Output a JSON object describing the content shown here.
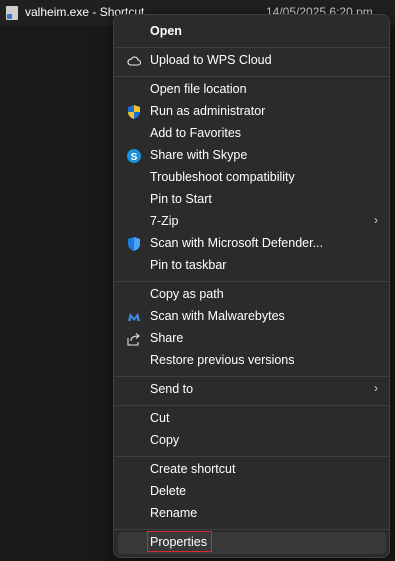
{
  "file": {
    "name": "valheim.exe - Shortcut",
    "date": "14/05/2025 6:20 pm"
  },
  "menu": {
    "open": "Open",
    "upload_wps": "Upload to WPS Cloud",
    "open_file_location": "Open file location",
    "run_as_admin": "Run as administrator",
    "add_favorites": "Add to Favorites",
    "share_skype": "Share with Skype",
    "troubleshoot": "Troubleshoot compatibility",
    "pin_start": "Pin to Start",
    "seven_zip": "7-Zip",
    "scan_defender": "Scan with Microsoft Defender...",
    "pin_taskbar": "Pin to taskbar",
    "copy_path": "Copy as path",
    "scan_malwarebytes": "Scan with Malwarebytes",
    "share": "Share",
    "restore_versions": "Restore previous versions",
    "send_to": "Send to",
    "cut": "Cut",
    "copy": "Copy",
    "create_shortcut": "Create shortcut",
    "delete": "Delete",
    "rename": "Rename",
    "properties": "Properties"
  },
  "colors": {
    "menu_bg": "#2b2b2b",
    "highlight_border": "#d42a2a",
    "skype_blue": "#1e90e0",
    "defender_blue": "#1f7ae0"
  }
}
